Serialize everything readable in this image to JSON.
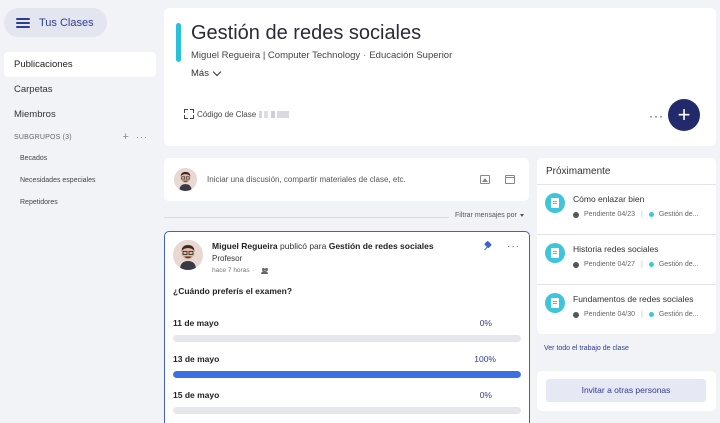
{
  "sidebar": {
    "home_button": "Tus Clases",
    "items": [
      {
        "label": "Publicaciones"
      },
      {
        "label": "Carpetas"
      },
      {
        "label": "Miembros"
      }
    ],
    "subgroups_header": "SUBGRUPOS (3)",
    "subgroups": [
      {
        "label": "Becados"
      },
      {
        "label": "Necesidades especiales"
      },
      {
        "label": "Repetidores"
      }
    ]
  },
  "header": {
    "title": "Gestión de redes sociales",
    "teacher": "Miguel Regueira | Computer Technology",
    "level": "Educación Superior",
    "more": "Más",
    "code_label": "Código de Clase",
    "accent_color": "#29c0d9"
  },
  "composer": {
    "placeholder": "Iniciar una discusión, compartir materiales de clase, etc."
  },
  "filter": {
    "label": "Filtrar mensajes por"
  },
  "post": {
    "author": "Miguel Regueira",
    "action": "publicó para",
    "target": "Gestión de redes sociales",
    "role": "Profesor",
    "time": "hace 7 horas",
    "question": "¿Cuándo preferís el examen?",
    "options": [
      {
        "label": "11 de mayo",
        "percent_text": "0%",
        "fraction": 0
      },
      {
        "label": "13 de mayo",
        "percent_text": "100%",
        "fraction": 1
      },
      {
        "label": "15 de mayo",
        "percent_text": "0%",
        "fraction": 0
      }
    ]
  },
  "upcoming": {
    "title": "Próximamente",
    "items": [
      {
        "name": "Cómo enlazar bien",
        "status": "Pendiente 04/23",
        "class": "Gestión de..."
      },
      {
        "name": "Historia redes sociales",
        "status": "Pendiente 04/27",
        "class": "Gestión de..."
      },
      {
        "name": "Fundamentos de redes sociales",
        "status": "Pendiente 04/30",
        "class": "Gestión de..."
      }
    ],
    "see_all": "Ver todo el trabajo de clase"
  },
  "invite": {
    "label": "Invitar a otras personas"
  }
}
